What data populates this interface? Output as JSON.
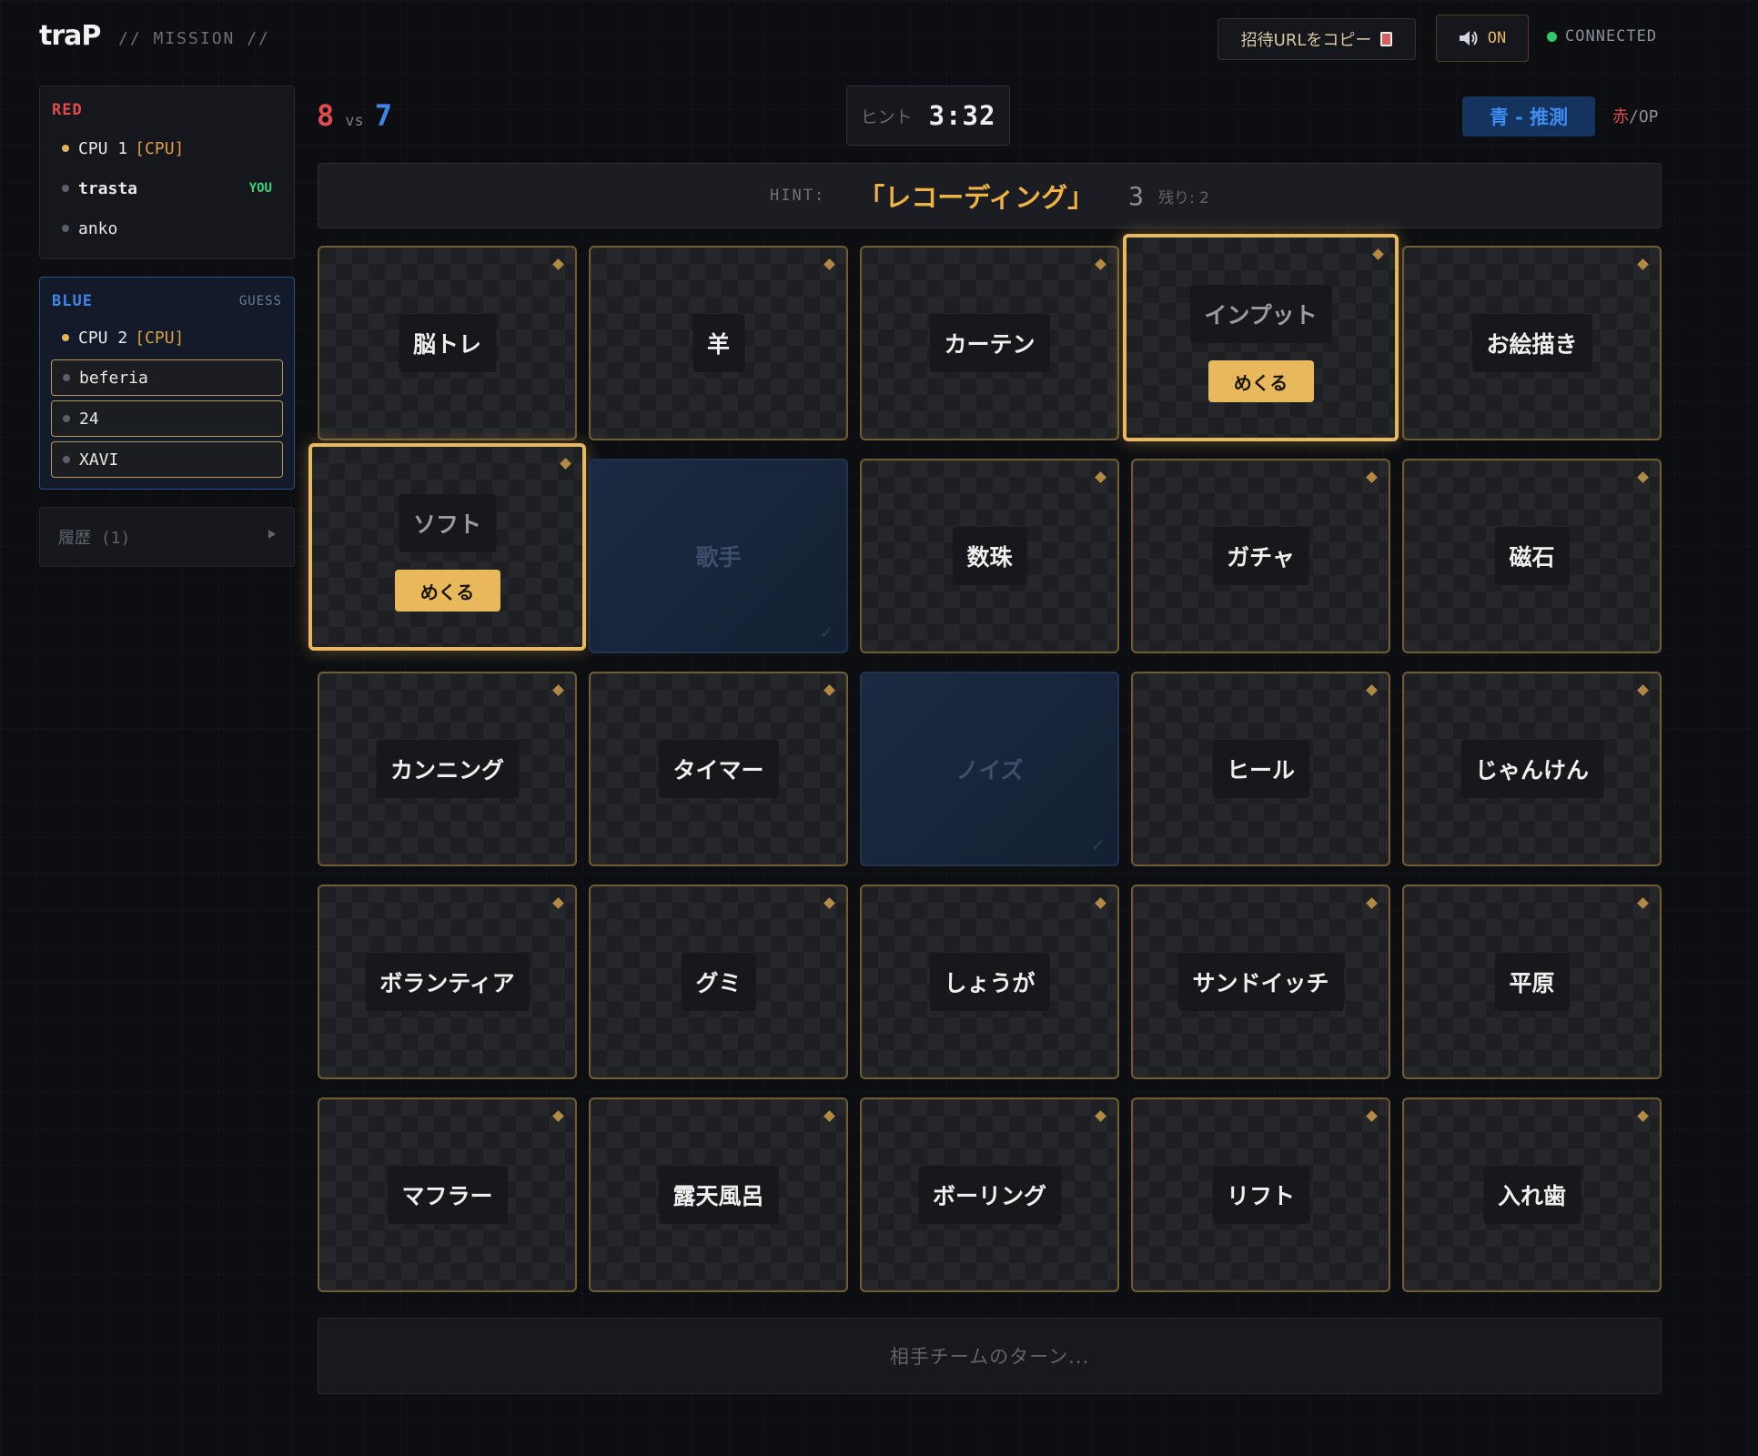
{
  "header": {
    "logo": "traP",
    "subtitle": "// MISSION //",
    "invite_label": "招待URLをコピー",
    "sound_label": "ON",
    "connection_status": "CONNECTED"
  },
  "teams": {
    "red": {
      "label": "RED",
      "players": [
        {
          "name": "CPU 1",
          "cpu_tag": "[CPU]"
        },
        {
          "name": "trasta",
          "you_tag": "YOU"
        },
        {
          "name": "anko"
        }
      ]
    },
    "blue": {
      "label": "BLUE",
      "status": "GUESS",
      "players": [
        {
          "name": "CPU 2",
          "cpu_tag": "[CPU]"
        },
        {
          "name": "beferia"
        },
        {
          "name": "24"
        },
        {
          "name": "XAVI"
        }
      ]
    }
  },
  "history_label": "履歴 (1)",
  "score": {
    "red": "8",
    "vs": "vs",
    "blue": "7"
  },
  "timer": {
    "label": "ヒント",
    "value": "3:32"
  },
  "phase": {
    "label": "青 - 推測",
    "op_red": "赤",
    "op_suffix": "/OP"
  },
  "hint": {
    "label": "HINT:",
    "word": "「レコーディング」",
    "count": "3",
    "remaining": "残り: 2"
  },
  "card_action_label": "めくる",
  "cards": [
    [
      "脳トレ",
      "羊",
      "カーテン",
      "インプット",
      "お絵描き"
    ],
    [
      "ソフト",
      "歌手",
      "数珠",
      "ガチャ",
      "磁石"
    ],
    [
      "カンニング",
      "タイマー",
      "ノイズ",
      "ヒール",
      "じゃんけん"
    ],
    [
      "ボランティア",
      "グミ",
      "しょうが",
      "サンドイッチ",
      "平原"
    ],
    [
      "マフラー",
      "露天風呂",
      "ボーリング",
      "リフト",
      "入れ歯"
    ]
  ],
  "check_mark": "✓",
  "footer_status": "相手チームのターン..."
}
